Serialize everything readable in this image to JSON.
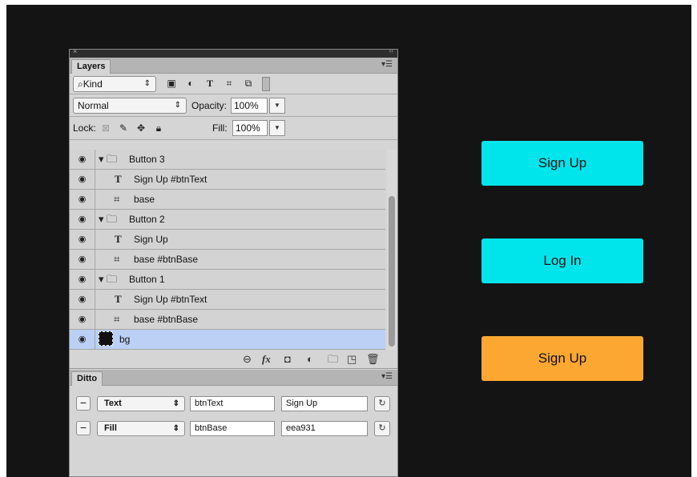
{
  "layers_panel": {
    "tab_label": "Layers",
    "filter": {
      "kind_label": "Kind"
    },
    "blend_mode": "Normal",
    "opacity_label": "Opacity:",
    "opacity_value": "100%",
    "lock_label": "Lock:",
    "fill_label": "Fill:",
    "fill_value": "100%",
    "layers": [
      {
        "name": "Button 3",
        "type": "group"
      },
      {
        "name": "Sign Up #btnText",
        "type": "text"
      },
      {
        "name": "base",
        "type": "shape"
      },
      {
        "name": "Button 2",
        "type": "group"
      },
      {
        "name": "Sign Up",
        "type": "text"
      },
      {
        "name": "base #btnBase",
        "type": "shape"
      },
      {
        "name": "Button 1",
        "type": "group"
      },
      {
        "name": "Sign Up #btnText",
        "type": "text"
      },
      {
        "name": "base #btnBase",
        "type": "shape"
      },
      {
        "name": "bg",
        "type": "fill",
        "selected": true
      }
    ]
  },
  "ditto_panel": {
    "tab_label": "Ditto",
    "rows": [
      {
        "property": "Text",
        "key": "btnText",
        "value": "Sign Up"
      },
      {
        "property": "Fill",
        "key": "btnBase",
        "value": "eea931"
      }
    ]
  },
  "preview": {
    "buttons": [
      {
        "label": "Sign Up",
        "color": "#00e5eb"
      },
      {
        "label": "Log In",
        "color": "#00e5eb"
      },
      {
        "label": "Sign Up",
        "color": "#fca731"
      }
    ]
  }
}
